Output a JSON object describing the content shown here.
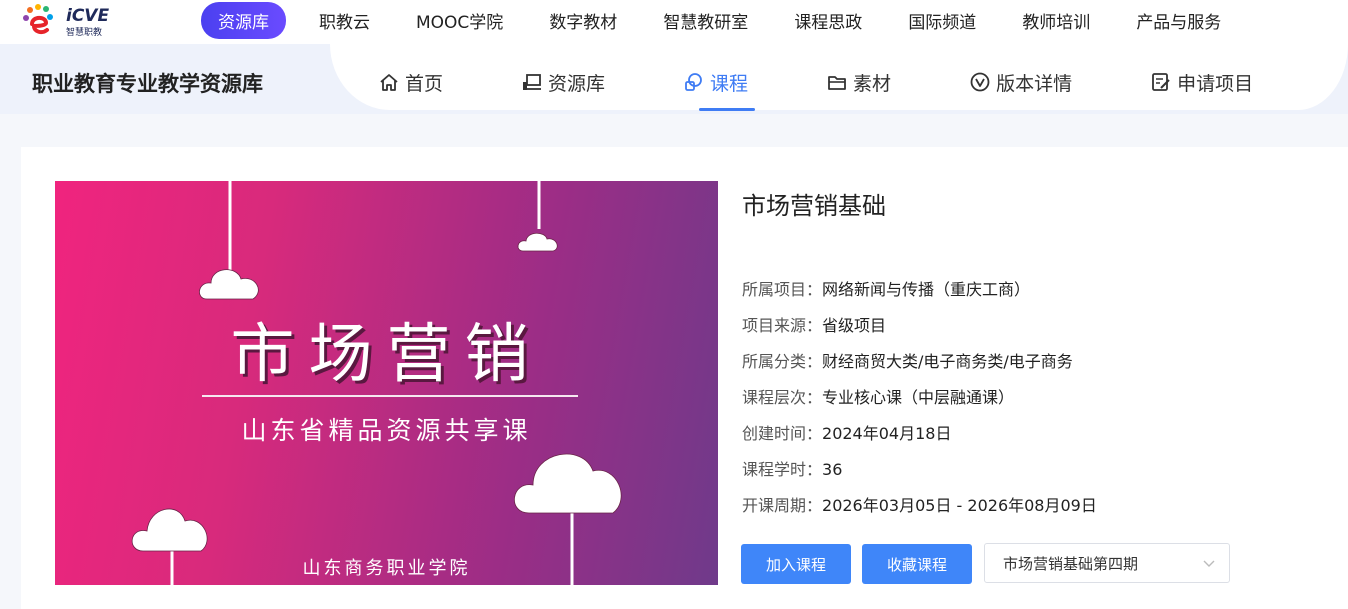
{
  "logo": {
    "brand": "iCVE",
    "sub": "智慧职教"
  },
  "topnav": [
    {
      "label": "资源库",
      "active": true
    },
    {
      "label": "职教云"
    },
    {
      "label": "MOOC学院"
    },
    {
      "label": "数字教材"
    },
    {
      "label": "智慧教研室"
    },
    {
      "label": "课程思政"
    },
    {
      "label": "国际频道"
    },
    {
      "label": "教师培训"
    },
    {
      "label": "产品与服务"
    }
  ],
  "site_title": "职业教育专业教学资源库",
  "subnav": [
    {
      "label": "首页",
      "icon": "home-icon"
    },
    {
      "label": "资源库",
      "icon": "library-icon"
    },
    {
      "label": "课程",
      "icon": "course-icon",
      "active": true
    },
    {
      "label": "素材",
      "icon": "folder-icon"
    },
    {
      "label": "版本详情",
      "icon": "version-icon"
    },
    {
      "label": "申请项目",
      "icon": "apply-icon"
    }
  ],
  "cover": {
    "title": "市场营销",
    "subtitle": "山东省精品资源共享课",
    "school": "山东商务职业学院"
  },
  "course": {
    "title": "市场营销基础",
    "info": [
      {
        "label": "所属项目：",
        "value": "网络新闻与传播（重庆工商）"
      },
      {
        "label": "项目来源：",
        "value": "省级项目"
      },
      {
        "label": "所属分类：",
        "value": "财经商贸大类/电子商务类/电子商务"
      },
      {
        "label": "课程层次：",
        "value": "专业核心课（中层融通课）"
      },
      {
        "label": "创建时间：",
        "value": "2024年04月18日"
      },
      {
        "label": "课程学时：",
        "value": "36"
      },
      {
        "label": "开课周期：",
        "value": "2026年03月05日 - 2026年08月09日"
      }
    ],
    "join_label": "加入课程",
    "favorite_label": "收藏课程",
    "term_select": "市场营销基础第四期"
  },
  "colors": {
    "primary": "#3f86f9",
    "nav_active": "#4b40f0",
    "subnav_active": "#3f7cf4"
  }
}
